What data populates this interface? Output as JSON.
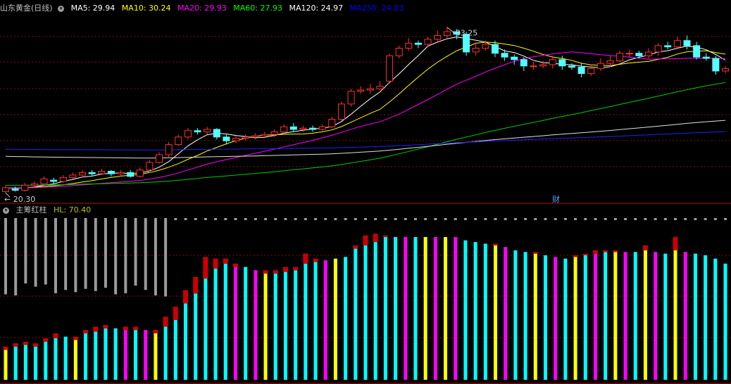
{
  "chart_data": [
    {
      "type": "candlestick",
      "title": "山东黄金(日线)",
      "ma_labels": [
        {
          "text": "MA5: 29.94",
          "color": "#ffffff"
        },
        {
          "text": "MA10: 30.24",
          "color": "#ffff00"
        },
        {
          "text": "MA20: 29.93",
          "color": "#ff00ff"
        },
        {
          "text": "MA60: 27.93",
          "color": "#00ff00"
        },
        {
          "text": "MA120: 24.97",
          "color": "#ffffff"
        },
        {
          "text": "MA250: 24.83",
          "color": "#0000ff"
        }
      ],
      "high_label": "33.25",
      "low_label": "20.30",
      "event_label": "财",
      "candles": [
        [
          20.3,
          20.6,
          20.2,
          20.8
        ],
        [
          20.5,
          20.4,
          20.3,
          20.7
        ],
        [
          20.4,
          20.8,
          20.3,
          21.0
        ],
        [
          20.8,
          20.9,
          20.6,
          21.1
        ],
        [
          20.9,
          21.3,
          20.8,
          21.5
        ],
        [
          21.2,
          21.1,
          20.9,
          21.4
        ],
        [
          21.1,
          21.4,
          21.0,
          21.6
        ],
        [
          21.4,
          21.6,
          21.3,
          21.8
        ],
        [
          21.6,
          21.8,
          21.4,
          22.0
        ],
        [
          21.8,
          21.7,
          21.5,
          22.0
        ],
        [
          21.7,
          21.9,
          21.6,
          22.1
        ],
        [
          21.9,
          21.7,
          21.5,
          22.0
        ],
        [
          21.7,
          21.8,
          21.5,
          22.0
        ],
        [
          21.8,
          21.5,
          21.4,
          22.0
        ],
        [
          21.5,
          22.0,
          21.4,
          22.2
        ],
        [
          22.0,
          22.6,
          21.9,
          22.8
        ],
        [
          22.6,
          23.2,
          22.5,
          23.4
        ],
        [
          23.2,
          24.0,
          23.0,
          24.2
        ],
        [
          24.0,
          24.6,
          23.9,
          24.8
        ],
        [
          24.6,
          25.1,
          24.4,
          25.3
        ],
        [
          25.1,
          25.0,
          24.8,
          25.3
        ],
        [
          25.0,
          25.2,
          24.8,
          25.4
        ],
        [
          25.2,
          24.6,
          24.4,
          25.3
        ],
        [
          24.6,
          24.3,
          24.0,
          24.8
        ],
        [
          24.3,
          24.5,
          24.1,
          24.7
        ],
        [
          24.5,
          24.6,
          24.3,
          24.8
        ],
        [
          24.6,
          24.7,
          24.4,
          24.9
        ],
        [
          24.7,
          24.8,
          24.5,
          25.0
        ],
        [
          24.8,
          25.0,
          24.6,
          25.2
        ],
        [
          25.0,
          25.4,
          24.8,
          25.6
        ],
        [
          25.4,
          25.2,
          25.0,
          25.7
        ],
        [
          25.2,
          25.3,
          25.0,
          25.5
        ],
        [
          25.3,
          25.2,
          25.0,
          25.5
        ],
        [
          25.2,
          25.4,
          25.1,
          25.6
        ],
        [
          25.4,
          26.0,
          25.3,
          26.2
        ],
        [
          26.0,
          27.2,
          25.9,
          27.4
        ],
        [
          27.2,
          28.2,
          27.0,
          28.4
        ],
        [
          28.2,
          28.3,
          28.0,
          28.6
        ],
        [
          28.3,
          28.4,
          28.0,
          28.8
        ],
        [
          28.4,
          28.6,
          28.3,
          29.0
        ],
        [
          29.0,
          31.0,
          28.9,
          31.2
        ],
        [
          31.0,
          31.6,
          30.8,
          31.8
        ],
        [
          31.6,
          32.0,
          31.4,
          32.4
        ],
        [
          32.0,
          31.9,
          31.6,
          32.2
        ],
        [
          31.9,
          32.3,
          31.7,
          32.5
        ],
        [
          32.3,
          32.6,
          32.0,
          33.0
        ],
        [
          32.6,
          32.9,
          32.4,
          33.25
        ],
        [
          32.9,
          32.7,
          32.3,
          33.1
        ],
        [
          32.7,
          31.3,
          31.0,
          32.9
        ],
        [
          31.3,
          31.6,
          31.0,
          32.1
        ],
        [
          31.6,
          31.9,
          31.4,
          32.2
        ],
        [
          31.9,
          31.2,
          30.9,
          32.2
        ],
        [
          31.2,
          30.9,
          30.6,
          31.5
        ],
        [
          30.9,
          30.7,
          30.3,
          31.1
        ],
        [
          30.7,
          30.2,
          29.8,
          30.9
        ],
        [
          30.2,
          30.2,
          29.9,
          30.5
        ],
        [
          30.2,
          30.3,
          30.0,
          30.6
        ],
        [
          30.3,
          30.7,
          30.0,
          31.0
        ],
        [
          30.7,
          30.2,
          29.9,
          31.0
        ],
        [
          30.2,
          30.1,
          29.9,
          30.4
        ],
        [
          30.1,
          29.6,
          29.3,
          30.4
        ],
        [
          29.6,
          30.0,
          29.4,
          30.3
        ],
        [
          30.0,
          30.4,
          29.8,
          30.8
        ],
        [
          30.4,
          30.6,
          30.1,
          31.0
        ],
        [
          30.6,
          31.2,
          30.5,
          31.4
        ],
        [
          31.2,
          31.2,
          30.9,
          31.5
        ],
        [
          31.2,
          31.0,
          30.8,
          31.4
        ],
        [
          31.0,
          31.3,
          30.8,
          31.6
        ],
        [
          31.3,
          31.8,
          31.0,
          32.0
        ],
        [
          31.8,
          31.7,
          31.5,
          32.1
        ],
        [
          31.7,
          32.2,
          31.5,
          32.5
        ],
        [
          32.2,
          31.8,
          31.5,
          32.6
        ],
        [
          31.8,
          30.9,
          30.7,
          32.1
        ],
        [
          30.9,
          30.8,
          30.6,
          31.2
        ],
        [
          30.8,
          29.8,
          29.5,
          31.0
        ],
        [
          29.8,
          30.0,
          29.6,
          30.2
        ]
      ],
      "ylim": [
        19.6,
        34.4
      ]
    },
    {
      "type": "bar",
      "title": "主筹红柱",
      "hl_label": "HL: 70.40",
      "ylim": [
        0,
        100
      ],
      "top_bars": [
        70,
        71,
        60,
        63,
        61,
        69,
        66,
        68,
        65,
        67,
        64,
        70,
        69,
        62,
        66,
        71,
        72
      ],
      "bars": [
        [
          18,
          20,
          "#ffff00"
        ],
        [
          20,
          22,
          "#00ffff"
        ],
        [
          21,
          23,
          "#00ffff"
        ],
        [
          20,
          22,
          "#00ffff"
        ],
        [
          23,
          25,
          "#00ffff"
        ],
        [
          25,
          28,
          "#00ffff"
        ],
        [
          26,
          26,
          "#00ffff"
        ],
        [
          24,
          26,
          "#ffff00"
        ],
        [
          28,
          30,
          "#00ffff"
        ],
        [
          29,
          32,
          "#00ffff"
        ],
        [
          31,
          33,
          "#00ffff"
        ],
        [
          31,
          31,
          "#00ffff"
        ],
        [
          30,
          32,
          "#ff00ff"
        ],
        [
          30,
          32,
          "#00ffff"
        ],
        [
          30,
          30,
          "#ff00ff"
        ],
        [
          28,
          30,
          "#ffff00"
        ],
        [
          32,
          38,
          "#00ffff"
        ],
        [
          36,
          44,
          "#00ffff"
        ],
        [
          46,
          54,
          "#00ffff"
        ],
        [
          52,
          62,
          "#00ffff"
        ],
        [
          61,
          74,
          "#00ffff"
        ],
        [
          67,
          73,
          "#00ffff"
        ],
        [
          70,
          73,
          "#00ffff"
        ],
        [
          68,
          70,
          "#ff00ff"
        ],
        [
          68,
          68,
          "#00ffff"
        ],
        [
          66,
          66,
          "#ff00ff"
        ],
        [
          64,
          66,
          "#ffff00"
        ],
        [
          64,
          66,
          "#00ffff"
        ],
        [
          65,
          68,
          "#00ffff"
        ],
        [
          66,
          68,
          "#00ffff"
        ],
        [
          70,
          76,
          "#00ffff"
        ],
        [
          71,
          73,
          "#00ffff"
        ],
        [
          72,
          72,
          "#ff00ff"
        ],
        [
          73,
          73,
          "#ffff00"
        ],
        [
          74,
          74,
          "#00ffff"
        ],
        [
          79,
          81,
          "#00ffff"
        ],
        [
          81,
          87,
          "#00ffff"
        ],
        [
          83,
          88,
          "#00ffff"
        ],
        [
          86,
          87,
          "#00ffff"
        ],
        [
          86,
          86,
          "#00ffff"
        ],
        [
          86,
          86,
          "#ff00ff"
        ],
        [
          86,
          86,
          "#00ffff"
        ],
        [
          86,
          86,
          "#ffff00"
        ],
        [
          86,
          86,
          "#ff00ff"
        ],
        [
          86,
          86,
          "#ffff00"
        ],
        [
          86,
          86,
          "#ff00ff"
        ],
        [
          84,
          84,
          "#00ffff"
        ],
        [
          83,
          83,
          "#00ffff"
        ],
        [
          82,
          82,
          "#00ffff"
        ],
        [
          81,
          82,
          "#ffff00"
        ],
        [
          80,
          80,
          "#ff00ff"
        ],
        [
          78,
          78,
          "#00ffff"
        ],
        [
          77,
          77,
          "#00ffff"
        ],
        [
          76,
          77,
          "#ffff00"
        ],
        [
          75,
          75,
          "#00ffff"
        ],
        [
          74,
          74,
          "#ff00ff"
        ],
        [
          73,
          73,
          "#00ffff"
        ],
        [
          74,
          75,
          "#ffff00"
        ],
        [
          75,
          76,
          "#00ffff"
        ],
        [
          76,
          78,
          "#ff00ff"
        ],
        [
          77,
          78,
          "#00ffff"
        ],
        [
          77,
          78,
          "#ffff00"
        ],
        [
          77,
          77,
          "#ff00ff"
        ],
        [
          77,
          77,
          "#00ffff"
        ],
        [
          78,
          81,
          "#ffff00"
        ],
        [
          77,
          77,
          "#ff00ff"
        ],
        [
          76,
          76,
          "#00ffff"
        ],
        [
          78,
          86,
          "#ffff00"
        ],
        [
          77,
          77,
          "#ff00ff"
        ],
        [
          76,
          76,
          "#00ffff"
        ],
        [
          75,
          75,
          "#00ffff"
        ],
        [
          73,
          73,
          "#00ffff"
        ],
        [
          70,
          70,
          "#00ffff"
        ]
      ]
    }
  ]
}
